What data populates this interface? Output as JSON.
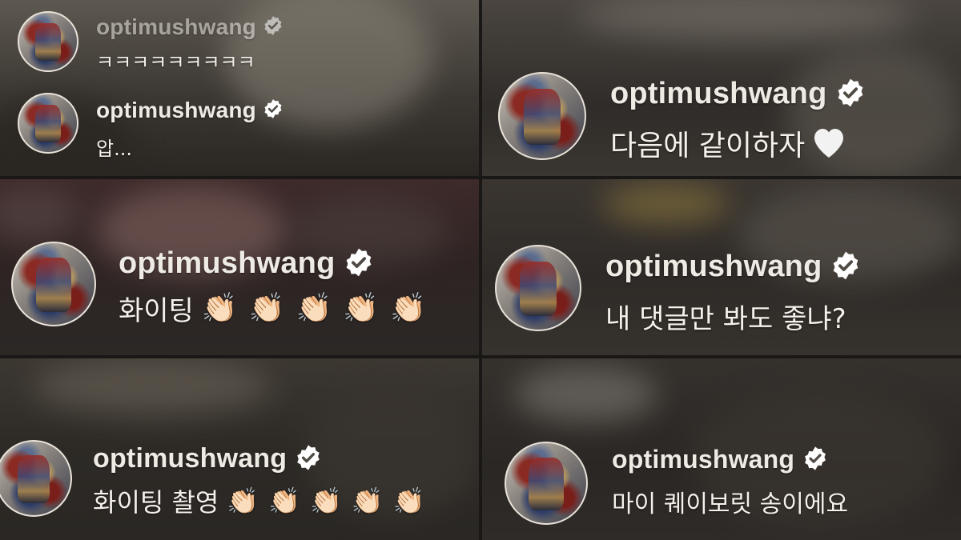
{
  "colors": {
    "username": "#eeeae4",
    "message": "#f4f0ea",
    "verified_badge": "#ffffff",
    "verified_check": "#4f4a44",
    "heart": "#f2f2f2"
  },
  "comments": [
    {
      "username": "optimushwang",
      "verified": true,
      "message": "ㅋㅋㅋㅋㅋㅋㅋㅋㅋ"
    },
    {
      "username": "optimushwang",
      "verified": true,
      "message": "압..."
    },
    {
      "username": "optimushwang",
      "verified": true,
      "message": "다음에 같이하자",
      "emoji": "heart-icon"
    },
    {
      "username": "optimushwang",
      "verified": true,
      "message": "화이팅",
      "emoji": "clapping-hands-icon",
      "emoji_count": 5,
      "emoji_char": "👏🏻"
    },
    {
      "username": "optimushwang",
      "verified": true,
      "message": "내 댓글만 봐도 좋냐?"
    },
    {
      "username": "optimushwang",
      "verified": true,
      "message": "화이팅 촬영",
      "emoji": "clapping-hands-icon",
      "emoji_count": 5,
      "emoji_char": "👏🏻"
    },
    {
      "username": "optimushwang",
      "verified": true,
      "message": "마이 퀘이보릿 송이에요"
    }
  ]
}
